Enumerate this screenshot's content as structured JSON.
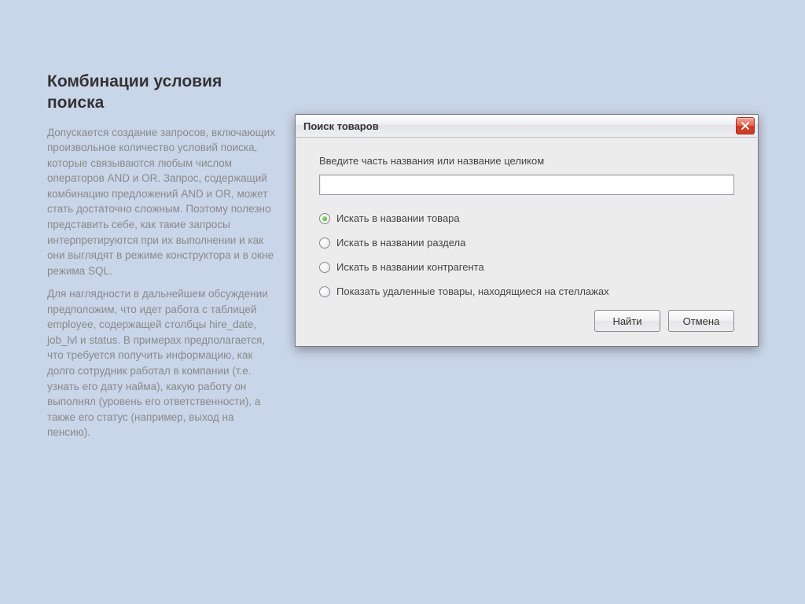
{
  "left": {
    "heading": "Комбинации условия поиска",
    "p1": "Допускается создание запросов, включающих произвольное количество условий поиска, которые связываются любым числом операторов AND и OR. Запрос, содержащий комбинацию предложений AND и OR, может стать достаточно сложным. Поэтому полезно представить себе, как такие запросы интерпретируются при их выполнении и как они выглядят в режиме конструктора и в окне режима SQL.",
    "p2": "Для наглядности в дальнейшем обсуждении предположим, что идет работа с таблицей employee, содержащей столбцы hire_date, job_lvl и status. В примерах предполагается, что требуется получить информацию, как долго сотрудник работал в компании (т.е. узнать его дату найма), какую работу он выполнял (уровень его ответственности), а также его статус (например, выход на пенсию)."
  },
  "dialog": {
    "title": "Поиск товаров",
    "prompt": "Введите часть названия или название целиком",
    "input_value": "",
    "options": [
      {
        "label": "Искать в названии товара",
        "selected": true
      },
      {
        "label": "Искать в названии раздела",
        "selected": false
      },
      {
        "label": "Искать в названии контрагента",
        "selected": false
      },
      {
        "label": "Показать удаленные товары, находящиеся на стеллажах",
        "selected": false
      }
    ],
    "buttons": {
      "find": "Найти",
      "cancel": "Отмена"
    }
  }
}
